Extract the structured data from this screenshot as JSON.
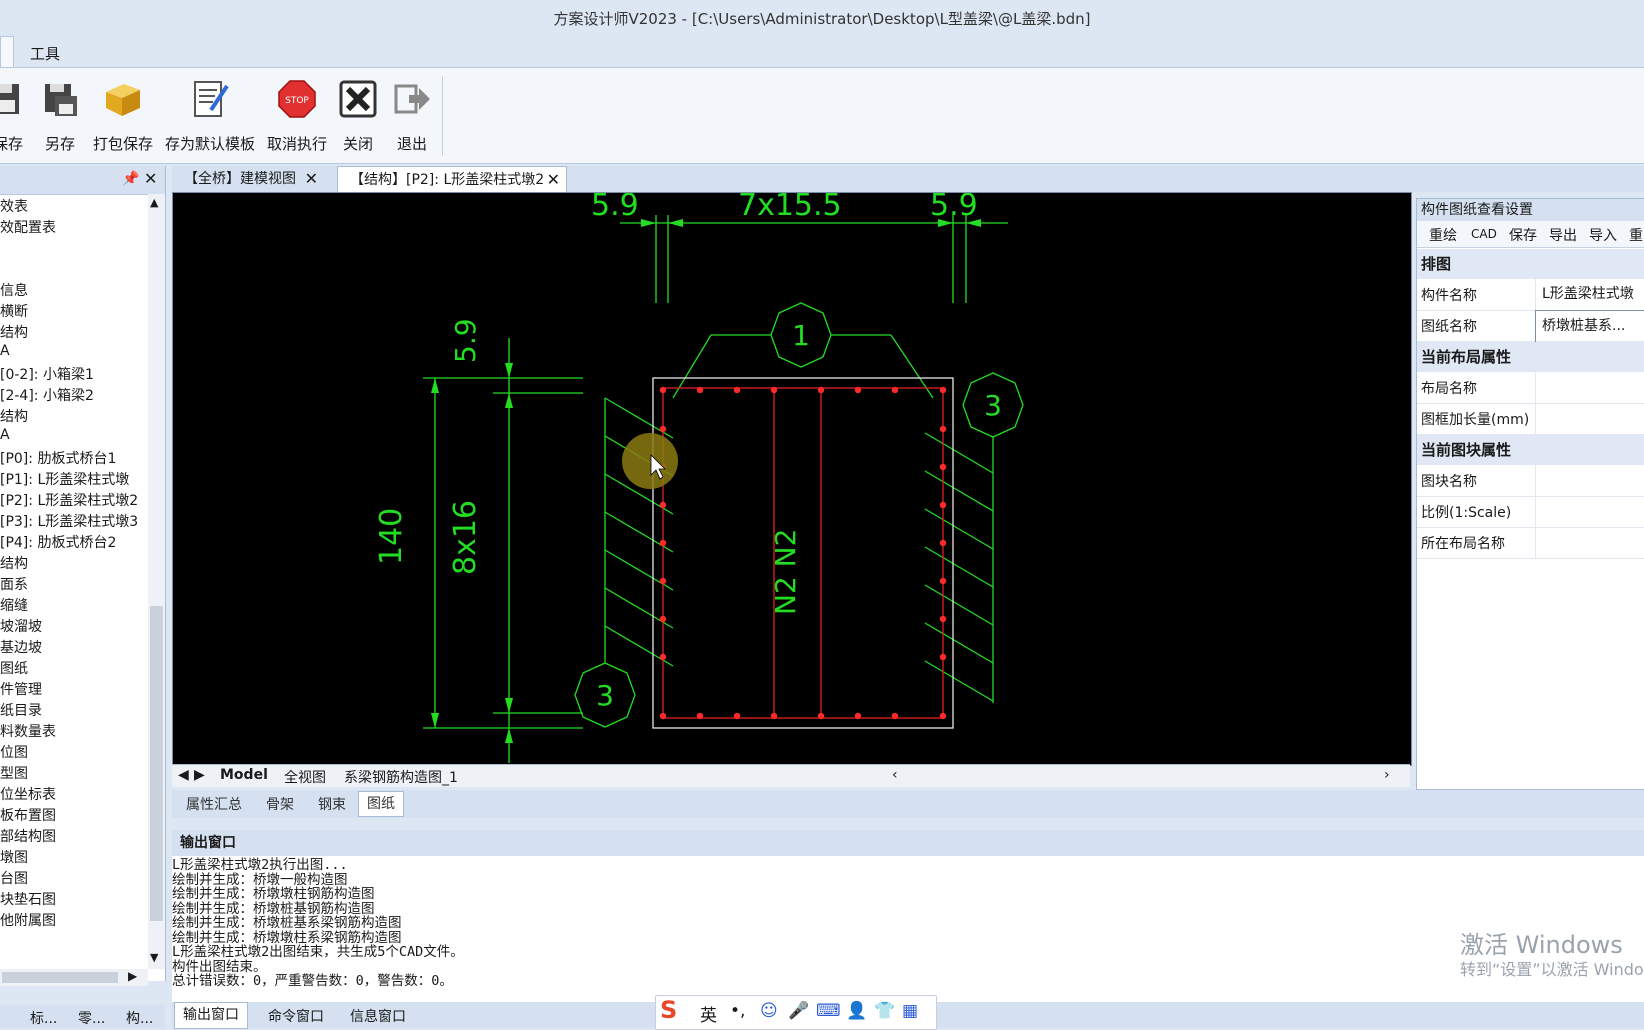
{
  "window": {
    "title": "方案设计师V2023 - [C:\\Users\\Administrator\\Desktop\\L型盖梁\\@L盖梁.bdn]"
  },
  "menu": {
    "tools": "工具"
  },
  "ribbon": [
    {
      "label": "保存",
      "icon": "save-icon"
    },
    {
      "label": "另存",
      "icon": "save-as-icon"
    },
    {
      "label": "打包保存",
      "icon": "package-icon"
    },
    {
      "label": "存为默认模板",
      "icon": "template-edit-icon"
    },
    {
      "label": "取消执行",
      "icon": "stop-icon"
    },
    {
      "label": "关闭",
      "icon": "close-icon"
    },
    {
      "label": "退出",
      "icon": "exit-icon"
    }
  ],
  "tree": {
    "items": [
      "效表",
      "效配置表",
      "",
      "",
      "信息",
      "横断",
      "结构",
      "A",
      "[0-2]: 小箱梁1",
      "[2-4]: 小箱梁2",
      "结构",
      "A",
      "[P0]: 肋板式桥台1",
      "[P1]: L形盖梁柱式墩",
      "[P2]: L形盖梁柱式墩2",
      "[P3]: L形盖梁柱式墩3",
      "[P4]: 肋板式桥台2",
      "结构",
      "面系",
      "缩缝",
      "坡溜坡",
      "基边坡",
      "图纸",
      "件管理",
      "纸目录",
      "料数量表",
      "位图",
      "型图",
      "位坐标表",
      "板布置图",
      "部结构图",
      "墩图",
      "台图",
      "块垫石图",
      "他附属图"
    ],
    "bottom_tabs": [
      "标...",
      "零...",
      "构..."
    ]
  },
  "doc_tabs": [
    "【全桥】建模视图",
    "【结构】[P2]: L形盖梁柱式墩2"
  ],
  "drawing": {
    "top_dims": [
      "5.9",
      "7x15.5",
      "5.9"
    ],
    "left_dims": [
      "5.9",
      "140",
      "8x16"
    ],
    "bubbles": [
      "1",
      "3",
      "3"
    ],
    "label": "N2 N2",
    "label_right": "N2"
  },
  "layout_tabs": [
    "Model",
    "全视图",
    "系梁钢筋构造图_1"
  ],
  "prop_tabs": [
    "属性汇总",
    "骨架",
    "钢束",
    "图纸"
  ],
  "right_panel": {
    "title": "构件图纸查看设置",
    "toolbar": [
      "重绘",
      "CAD",
      "保存",
      "导出",
      "导入",
      "重"
    ],
    "sections": {
      "s1": "排图",
      "s2": "当前布局属性",
      "s3": "当前图块属性"
    },
    "rows": {
      "component_name": {
        "k": "构件名称",
        "v": "L形盖梁柱式墩"
      },
      "drawing_name": {
        "k": "图纸名称",
        "v": "桥墩桩基系..."
      },
      "layout_name": {
        "k": "布局名称",
        "v": ""
      },
      "frame_extend": {
        "k": "图框加长量(mm)",
        "v": ""
      },
      "block_name": {
        "k": "图块名称",
        "v": ""
      },
      "scale": {
        "k": "比例(1:Scale)",
        "v": ""
      },
      "in_layout": {
        "k": "所在布局名称",
        "v": ""
      }
    }
  },
  "output": {
    "title": "输出窗口",
    "lines": [
      "    L形盖梁柱式墩2执行出图...",
      "     绘制并生成：桥墩一般构造图",
      "     绘制并生成：桥墩墩柱钢筋构造图",
      "     绘制并生成：桥墩桩基钢筋构造图",
      "     绘制并生成：桥墩桩基系梁钢筋构造图",
      "     绘制并生成：桥墩墩柱系梁钢筋构造图",
      "    L形盖梁柱式墩2出图结束，共生成5个CAD文件。",
      "构件出图结束。",
      "总计错误数：0，严重警告数：0，警告数：0。"
    ],
    "tabs": [
      "输出窗口",
      "命令窗口",
      "信息窗口"
    ]
  },
  "watermark": {
    "line1": "激活 Windows",
    "line2": "转到“设置”以激活 Windows。"
  },
  "ime": {
    "lang": "英",
    "punct": "•,"
  },
  "colors": {
    "green": "#22dd22",
    "red": "#e02020",
    "rebar": "#ff2a2a",
    "white": "#e6e6e6"
  }
}
